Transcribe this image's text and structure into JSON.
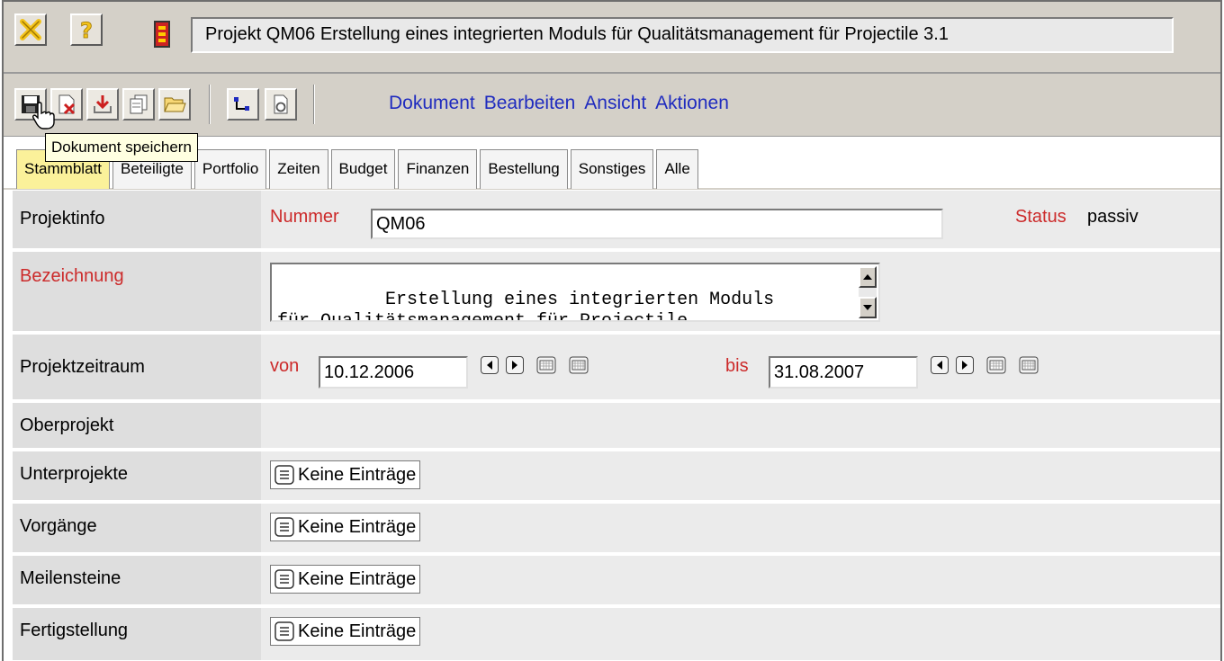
{
  "window": {
    "title": "Projekt QM06 Erstellung eines integrierten Moduls für Qualitätsmanagement für Projectile 3.1"
  },
  "titlebar_icons": [
    "close-x-icon",
    "help-icon",
    "project-icon"
  ],
  "toolbar": {
    "tools": [
      "save-icon",
      "discard-icon",
      "download-icon",
      "copy-icon",
      "open-folder-icon",
      "hierarchy-icon",
      "refresh-document-icon"
    ],
    "menu": [
      "Dokument",
      "Bearbeiten",
      "Ansicht",
      "Aktionen"
    ],
    "tooltip": "Dokument speichern"
  },
  "tabs": [
    {
      "label": "Stammblatt",
      "active": true
    },
    {
      "label": "Beteiligte",
      "active": false
    },
    {
      "label": "Portfolio",
      "active": false
    },
    {
      "label": "Zeiten",
      "active": false
    },
    {
      "label": "Budget",
      "active": false
    },
    {
      "label": "Finanzen",
      "active": false
    },
    {
      "label": "Bestellung",
      "active": false
    },
    {
      "label": "Sonstiges",
      "active": false
    },
    {
      "label": "Alle",
      "active": false
    }
  ],
  "form": {
    "projektinfo_label": "Projektinfo",
    "nummer_label": "Nummer",
    "nummer_value": "QM06",
    "status_label": "Status",
    "status_value": "passiv",
    "bezeichnung_label": "Bezeichnung",
    "bezeichnung_value": "Erstellung eines integrierten Moduls\nfür Qualitätsmanagement für Projectile",
    "zeitraum_label": "Projektzeitraum",
    "von_label": "von",
    "von_value": "10.12.2006",
    "bis_label": "bis",
    "bis_value": "31.08.2007",
    "oberprojekt_label": "Oberprojekt",
    "unterprojekte_label": "Unterprojekte",
    "vorgaenge_label": "Vorgänge",
    "meilensteine_label": "Meilensteine",
    "fertigstellung_label": "Fertigstellung",
    "empty_list_text": "Keine Einträge"
  },
  "colors": {
    "menu_link": "#1f2bbf",
    "required_label": "#cc2a2a",
    "active_tab": "#fbf19a",
    "label_cell": "#dedede",
    "content_cell": "#ebebeb"
  }
}
